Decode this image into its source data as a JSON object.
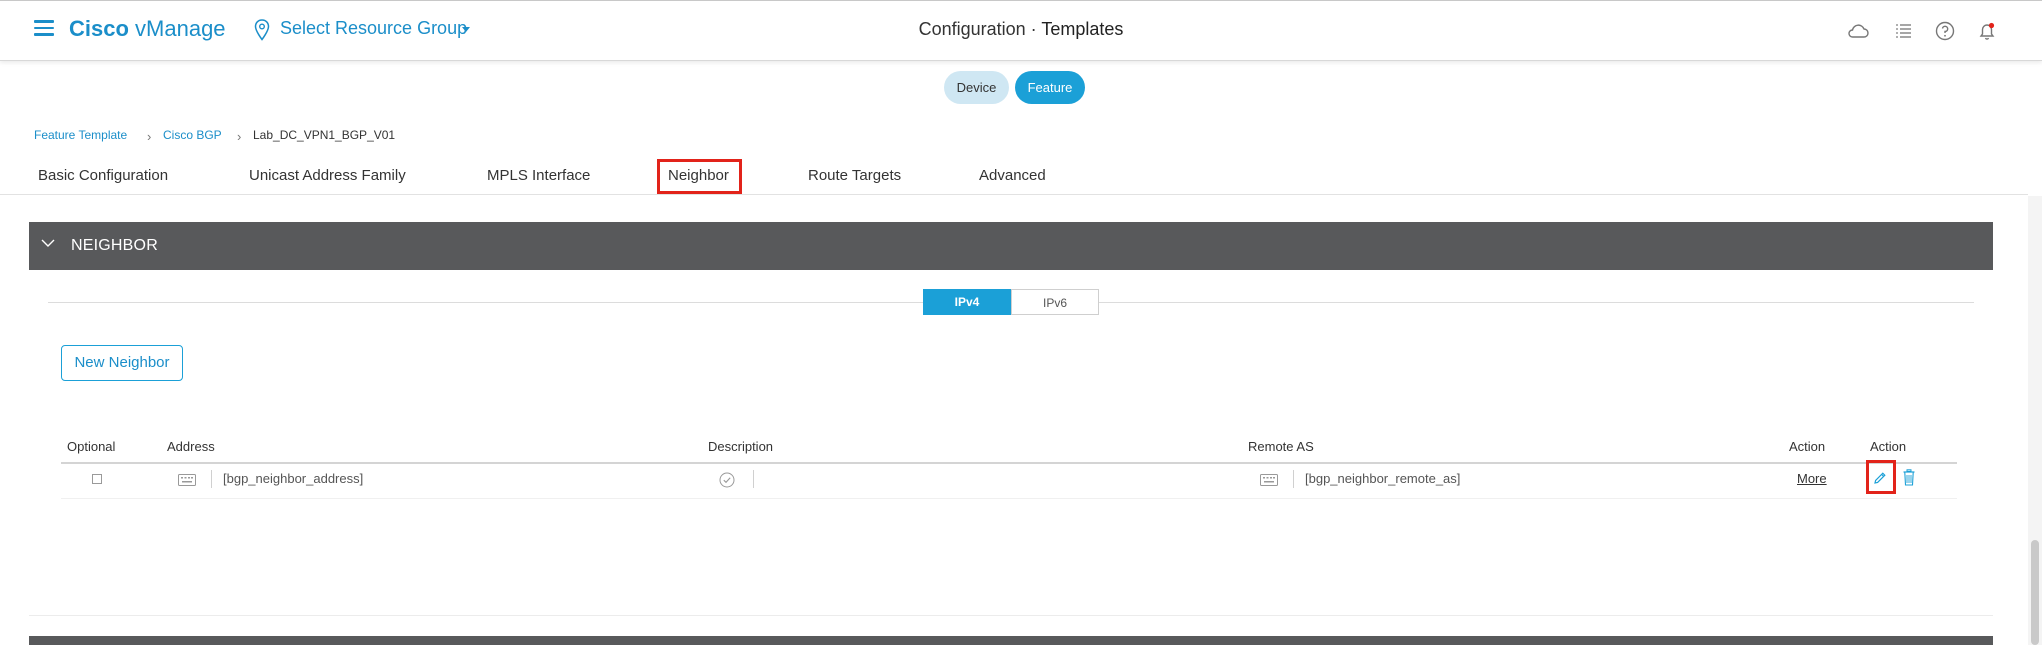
{
  "header": {
    "brand_bold": "Cisco",
    "brand_light": " vManage",
    "resource_group": "Select Resource Group",
    "title_prefix": "Configuration",
    "title_dot": "·",
    "title_main": "Templates",
    "icons": [
      "cloud-icon",
      "list-icon",
      "help-icon",
      "bell-icon"
    ]
  },
  "toggle": {
    "device": "Device",
    "feature": "Feature",
    "active": "Feature"
  },
  "breadcrumb": {
    "level1": "Feature Template",
    "level2": "Cisco BGP",
    "current": "Lab_DC_VPN1_BGP_V01"
  },
  "tabs": {
    "basic": "Basic Configuration",
    "unicast": "Unicast Address Family",
    "mpls": "MPLS Interface",
    "neighbor": "Neighbor",
    "route_targets": "Route Targets",
    "advanced": "Advanced",
    "active": "Neighbor"
  },
  "section": {
    "title": "NEIGHBOR",
    "ip_tabs": {
      "ipv4": "IPv4",
      "ipv6": "IPv6",
      "active": "IPv4"
    },
    "new_button": "New Neighbor",
    "columns": {
      "optional": "Optional",
      "address": "Address",
      "description": "Description",
      "remote_as": "Remote AS",
      "action1": "Action",
      "action2": "Action"
    },
    "row": {
      "address": "[bgp_neighbor_address]",
      "remote_as": "[bgp_neighbor_remote_as]",
      "more": "More"
    }
  },
  "colors": {
    "accent": "#1ba0d7",
    "link": "#1b8ec9",
    "highlight": "#e2231a",
    "section_bar": "#58595b"
  }
}
